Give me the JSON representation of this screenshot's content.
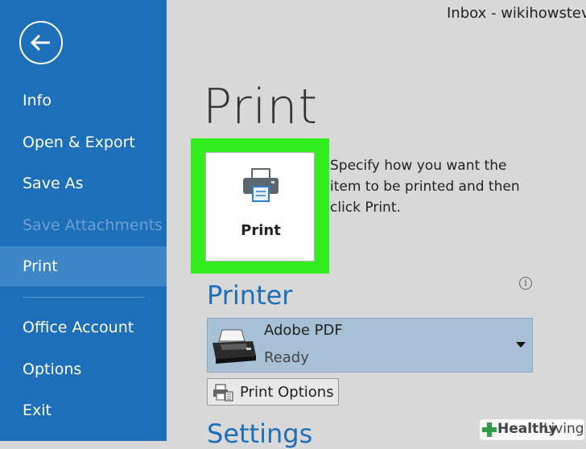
{
  "window": {
    "title": "Inbox - wikihowstev"
  },
  "sidebar": {
    "items": [
      {
        "label": "Info",
        "state": "normal"
      },
      {
        "label": "Open & Export",
        "state": "normal"
      },
      {
        "label": "Save As",
        "state": "normal"
      },
      {
        "label": "Save Attachments",
        "state": "disabled"
      },
      {
        "label": "Print",
        "state": "selected"
      },
      {
        "label": "Office Account",
        "state": "normal"
      },
      {
        "label": "Options",
        "state": "normal"
      },
      {
        "label": "Exit",
        "state": "normal"
      }
    ],
    "back_icon": "back-arrow-icon"
  },
  "main": {
    "title": "Print",
    "print_button": {
      "label": "Print",
      "icon": "printer-icon"
    },
    "description": "Specify how you want the item to be printed and then click Print.",
    "printer_section": {
      "heading": "Printer",
      "info_icon": "i",
      "selected_printer": {
        "name": "Adobe PDF",
        "status": "Ready"
      },
      "options_button": "Print Options"
    },
    "settings_section": {
      "heading": "Settings"
    }
  },
  "watermark": {
    "part1": "Healthy",
    "part2": "Living"
  },
  "colors": {
    "sidebar": "#1e6fb9",
    "sidebar_selected": "#3d86c8",
    "highlight": "#33ee1f",
    "section_heading": "#1e6fb9"
  }
}
